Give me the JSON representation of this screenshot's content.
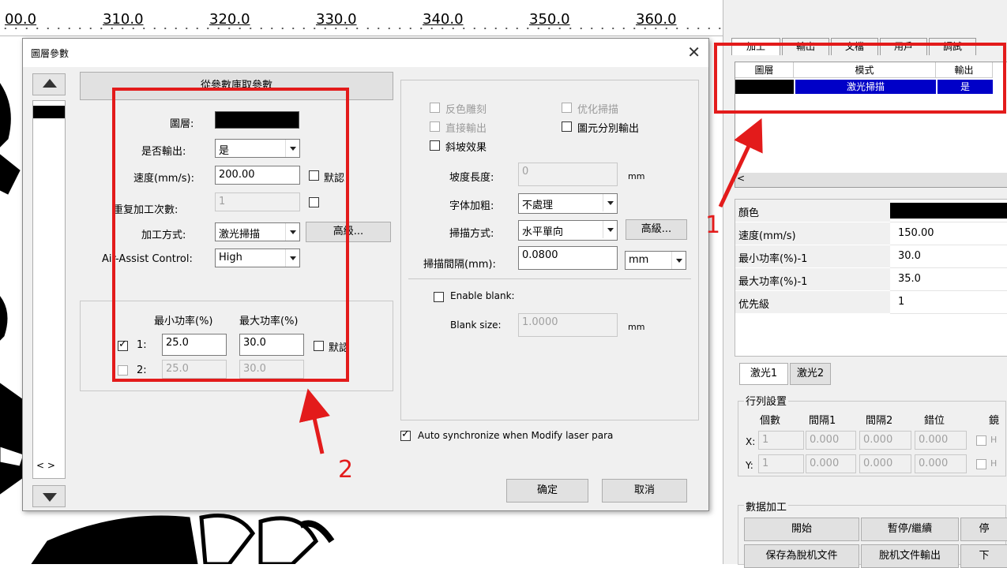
{
  "ruler": {
    "labels": [
      "00.0",
      "310.0",
      "320.0",
      "330.0",
      "340.0",
      "350.0",
      "360.0"
    ]
  },
  "dialog": {
    "title": "圖層參數",
    "read_button": "從參數庫取參數",
    "layer_label": "圖層:",
    "layer_color": "#000000",
    "output_label": "是否輸出:",
    "output_value": "是",
    "speed_label": "速度(mm/s):",
    "speed_value": "200.00",
    "default_label": "默認",
    "repeat_label": "重复加工次數:",
    "repeat_value": "1",
    "mode_label": "加工方式:",
    "mode_value": "激光掃描",
    "advanced_label": "高級...",
    "air_label": "Air-Assist Control:",
    "air_value": "High",
    "min_power_header": "最小功率(%)",
    "max_power_header": "最大功率(%)",
    "laser1_label": "1:",
    "laser1_min": "25.0",
    "laser1_max": "30.0",
    "laser2_label": "2:",
    "laser2_min": "25.0",
    "laser2_max": "30.0",
    "power_default_label": "默認",
    "invert_label": "反色雕刻",
    "optimize_label": "优化掃描",
    "direct_output_label": "直接輸出",
    "separate_output_label": "圖元分別輸出",
    "slope_label": "斜坡效果",
    "slope_len_label": "坡度長度:",
    "slope_len_value": "0",
    "unit_mm": "mm",
    "bold_label": "字体加粗:",
    "bold_value": "不處理",
    "scan_mode_label": "掃描方式:",
    "scan_mode_value": "水平單向",
    "scan_adv_label": "高級...",
    "interval_label": "掃描間隔(mm):",
    "interval_value": "0.0800",
    "interval_unit": "mm",
    "blank_label": "Enable blank:",
    "blank_size_label": "Blank size:",
    "blank_size_value": "1.0000",
    "blank_unit": "mm",
    "autosync_label": "Auto synchronize when Modify laser para",
    "ok_label": "确定",
    "cancel_label": "取消"
  },
  "annotations": {
    "label1": "1",
    "label2": "2"
  },
  "right_panel": {
    "tabs": [
      "加工",
      "輸出",
      "文檔",
      "用戶",
      "調試"
    ],
    "layer_table": {
      "headers": [
        "圖層",
        "模式",
        "輸出"
      ],
      "row": {
        "mode": "激光掃描",
        "output": "是"
      }
    },
    "props": [
      {
        "label": "顏色",
        "value": ""
      },
      {
        "label": "速度(mm/s)",
        "value": "150.00"
      },
      {
        "label": "最小功率(%)-1",
        "value": "30.0"
      },
      {
        "label": "最大功率(%)-1",
        "value": "35.0"
      },
      {
        "label": "优先級",
        "value": "1"
      }
    ],
    "laser_tabs": [
      "激光1",
      "激光2"
    ],
    "array_title": "行列設置",
    "array_headers": [
      "個數",
      "間隔1",
      "間隔2",
      "錯位",
      "鏡"
    ],
    "x_label": "X:",
    "y_label": "Y:",
    "x_row": [
      "1",
      "0.000",
      "0.000",
      "0.000"
    ],
    "y_row": [
      "1",
      "0.000",
      "0.000",
      "0.000"
    ],
    "mirror_label": "H",
    "data_title": "數据加工",
    "buttons_row1": [
      "開始",
      "暫停/繼續",
      "停"
    ],
    "buttons_row2": [
      "保存為脫机文件",
      "脫机文件輸出",
      "下"
    ]
  }
}
